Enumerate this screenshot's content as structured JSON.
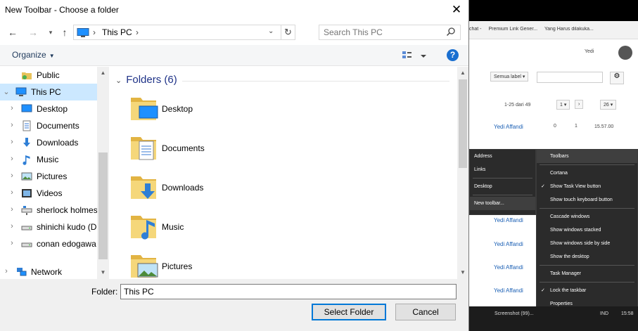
{
  "dialog": {
    "title": "New Toolbar - Choose a folder",
    "close_glyph": "✕",
    "address": {
      "path": "This PC",
      "placeholder_search": "Search This PC"
    },
    "toolbar": {
      "organize": "Organize"
    },
    "nav_items": [
      {
        "label": "Public",
        "icon": "public-folder-icon"
      },
      {
        "label": "This PC",
        "icon": "pc-icon",
        "selected": true
      },
      {
        "label": "Desktop",
        "icon": "desktop-icon"
      },
      {
        "label": "Documents",
        "icon": "documents-icon"
      },
      {
        "label": "Downloads",
        "icon": "downloads-icon"
      },
      {
        "label": "Music",
        "icon": "music-icon"
      },
      {
        "label": "Pictures",
        "icon": "pictures-icon"
      },
      {
        "label": "Videos",
        "icon": "videos-icon"
      },
      {
        "label": "sherlock holmes",
        "icon": "network-drive-icon"
      },
      {
        "label": "shinichi kudo (D",
        "icon": "drive-icon"
      },
      {
        "label": "conan edogawa",
        "icon": "drive-icon"
      },
      {
        "label": "Network",
        "icon": "network-icon"
      }
    ],
    "content": {
      "section_title": "Folders (6)",
      "folders": [
        {
          "name": "Desktop",
          "icon": "desktop-folder-icon"
        },
        {
          "name": "Documents",
          "icon": "documents-folder-icon"
        },
        {
          "name": "Downloads",
          "icon": "downloads-folder-icon"
        },
        {
          "name": "Music",
          "icon": "music-folder-icon"
        },
        {
          "name": "Pictures",
          "icon": "pictures-folder-icon"
        }
      ]
    },
    "footer": {
      "folder_label": "Folder:",
      "folder_value": "This PC",
      "select_button": "Select Folder",
      "cancel_button": "Cancel"
    }
  },
  "background": {
    "bookmarks": [
      "chat -",
      "Premium Link Gener...",
      "Yang Harus dilakuka..."
    ],
    "user": "Yedi",
    "gmail": {
      "label_button": "Semua label",
      "pager": "1-25 dari 49",
      "page": "1",
      "per_page": "26",
      "sender": "Yedi Affandi",
      "count_a": "0",
      "count_b": "1",
      "time": "15.57.00",
      "list_senders": [
        "Yedi Affandi",
        "Yedi Affandi",
        "Yedi Affandi",
        "Yedi Affandi"
      ]
    },
    "context_menu_left": [
      "Address",
      "Links",
      "Desktop",
      "New toolbar..."
    ],
    "context_menu_right": [
      "Toolbars",
      "Cortana",
      "Show Task View button",
      "Show touch keyboard button",
      "Cascade windows",
      "Show windows stacked",
      "Show windows side by side",
      "Show the desktop",
      "Task Manager",
      "Lock the taskbar",
      "Properties"
    ],
    "taskbar": {
      "item": "Screenshot (99)...",
      "lang": "IND",
      "time": "15:58"
    }
  },
  "colors": {
    "selection": "#cce8ff",
    "accent": "#0078d7",
    "header_text": "#1e3287"
  }
}
